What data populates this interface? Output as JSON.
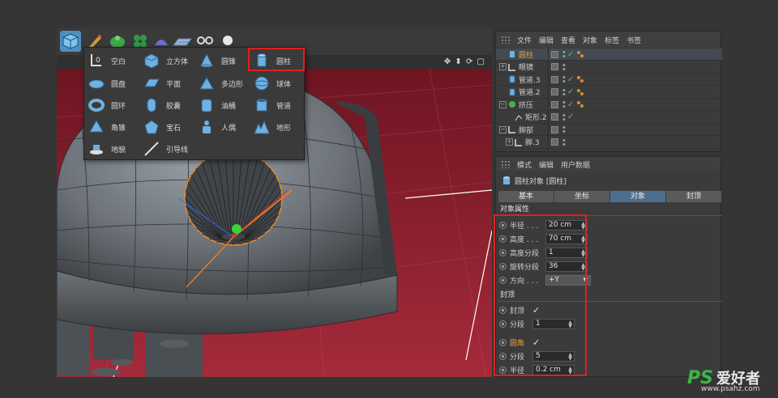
{
  "toolbar": {
    "icons": [
      "cube-icon",
      "pen-icon",
      "subdivision-icon",
      "cloner-icon",
      "deformer-icon",
      "floor-icon",
      "camera-icon",
      "light-icon"
    ]
  },
  "primitive_menu": {
    "items": [
      {
        "label": "空白",
        "icon": "null-icon"
      },
      {
        "label": "立方体",
        "icon": "cube-icon"
      },
      {
        "label": "圆锥",
        "icon": "cone-icon"
      },
      {
        "label": "圆柱",
        "icon": "cylinder-icon",
        "highlighted": true
      },
      {
        "label": "圆盘",
        "icon": "disc-icon"
      },
      {
        "label": "平面",
        "icon": "plane-icon"
      },
      {
        "label": "多边形",
        "icon": "polygon-icon"
      },
      {
        "label": "球体",
        "icon": "sphere-icon"
      },
      {
        "label": "圆环",
        "icon": "torus-icon"
      },
      {
        "label": "胶囊",
        "icon": "capsule-icon"
      },
      {
        "label": "油桶",
        "icon": "oiltank-icon"
      },
      {
        "label": "管道",
        "icon": "tube-icon"
      },
      {
        "label": "角锥",
        "icon": "pyramid-icon"
      },
      {
        "label": "宝石",
        "icon": "platonic-icon"
      },
      {
        "label": "人偶",
        "icon": "figure-icon"
      },
      {
        "label": "地形",
        "icon": "landscape-icon"
      },
      {
        "label": "地貌",
        "icon": "relief-icon"
      },
      {
        "label": "引导线",
        "icon": "guide-icon"
      }
    ]
  },
  "object_manager": {
    "menu": [
      "文件",
      "编辑",
      "查看",
      "对象",
      "标签",
      "书签"
    ],
    "rows": [
      {
        "name": "圆柱",
        "icon": "cylinder-icon",
        "selected": true,
        "name_color": "#e3a43a",
        "check": true,
        "tag": true,
        "expander": ""
      },
      {
        "name": "眼镜",
        "icon": "null-icon",
        "check": false,
        "tag": false,
        "expander": "+"
      },
      {
        "name": "管道.3",
        "icon": "tube-icon",
        "check": true,
        "tag": true,
        "expander": ""
      },
      {
        "name": "管道.2",
        "icon": "tube-icon",
        "check": true,
        "tag": true,
        "expander": ""
      },
      {
        "name": "挤压",
        "icon": "extrude-icon",
        "check": true,
        "tag": true,
        "expander": "−"
      },
      {
        "name": "矩形.2",
        "icon": "spline-icon",
        "check": true,
        "tag": false,
        "expander": ""
      },
      {
        "name": "脚部",
        "icon": "null-icon",
        "check": false,
        "tag": false,
        "expander": "−"
      },
      {
        "name": "脚.3",
        "icon": "null-icon",
        "check": false,
        "tag": false,
        "expander": "+"
      }
    ]
  },
  "attribute_manager": {
    "menu": [
      "模式",
      "编辑",
      "用户数据"
    ],
    "title": "圆柱对象 [圆柱]",
    "tabs": [
      "基本",
      "坐标",
      "对象",
      "封顶"
    ],
    "active_tab": "对象",
    "section_object": "对象属性",
    "params": [
      {
        "label": "半径 . . .",
        "value": "20 cm"
      },
      {
        "label": "高度 . . .",
        "value": "70 cm"
      },
      {
        "label": "高度分段",
        "value": "1"
      },
      {
        "label": "旋转分段",
        "value": "36"
      },
      {
        "label": "方向 . . .",
        "value": "+Y"
      }
    ],
    "section_caps": "封顶",
    "caps": [
      {
        "label": "封顶",
        "value": "✓"
      },
      {
        "label": "分段",
        "value": "1"
      },
      {
        "label": "圆角",
        "value": "✓"
      },
      {
        "label": "分段",
        "value": "5"
      },
      {
        "label": "半径",
        "value": "0.2 cm"
      }
    ]
  },
  "watermark": {
    "logo": "PS爱好者",
    "url": "www.psahz.com"
  },
  "colors": {
    "accent_red": "#e02020",
    "selected_orange": "#e3a43a",
    "active_tab": "#4e6e8f",
    "floor_red": "#8a1d2a"
  }
}
